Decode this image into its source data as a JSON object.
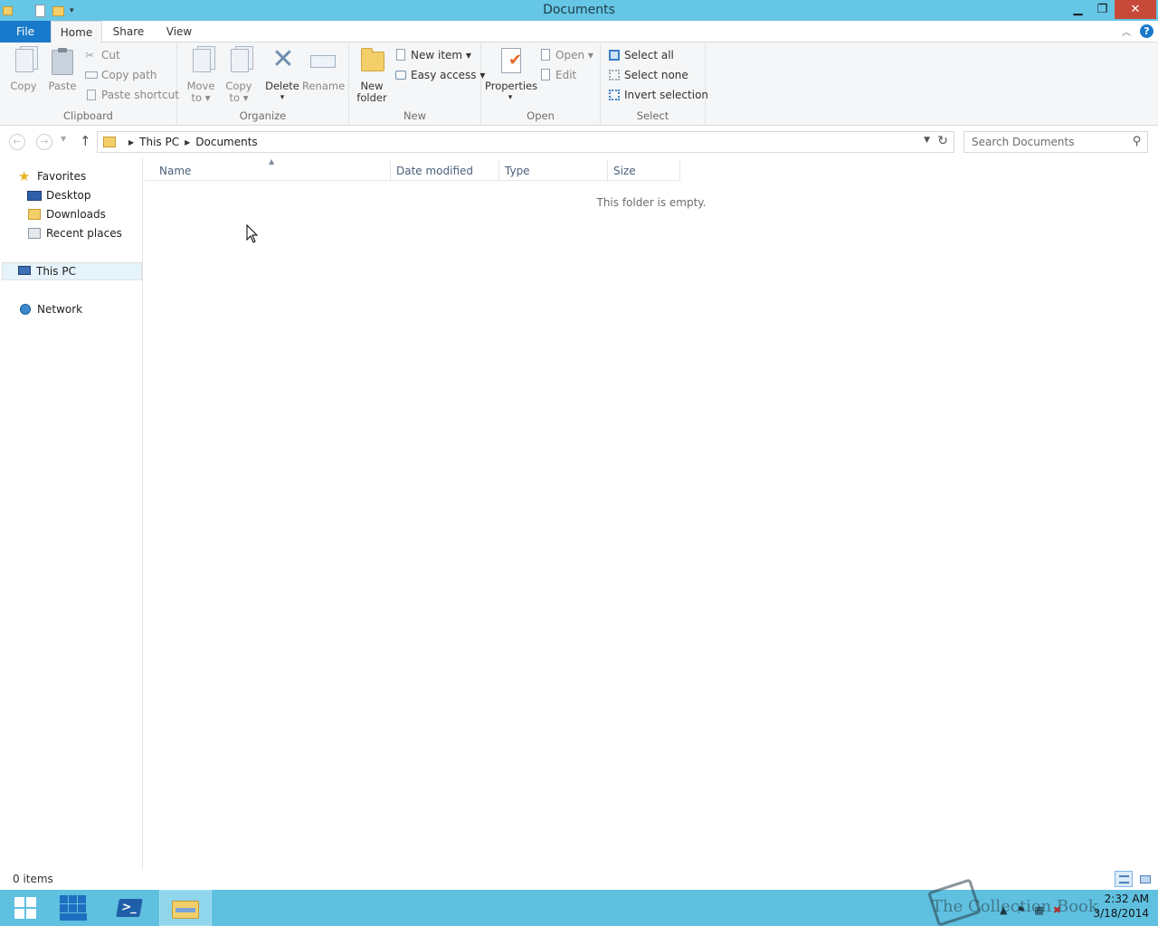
{
  "window": {
    "title": "Documents",
    "min_symbol": "▁",
    "max_symbol": "❐",
    "close_symbol": "✕"
  },
  "ribbon_tabs": {
    "file": "File",
    "home": "Home",
    "share": "Share",
    "view": "View"
  },
  "ribbon": {
    "clipboard": {
      "label": "Clipboard",
      "copy": "Copy",
      "paste": "Paste",
      "cut": "Cut",
      "copy_path": "Copy path",
      "paste_shortcut": "Paste shortcut"
    },
    "organize": {
      "label": "Organize",
      "move_to_1": "Move",
      "move_to_2": "to ▾",
      "copy_to_1": "Copy",
      "copy_to_2": "to ▾",
      "delete": "Delete",
      "delete_arrow": "▾",
      "rename": "Rename"
    },
    "new": {
      "label": "New",
      "new_folder_1": "New",
      "new_folder_2": "folder",
      "new_item": "New item ▾",
      "easy_access": "Easy access ▾"
    },
    "open": {
      "label": "Open",
      "properties": "Properties",
      "properties_arrow": "▾",
      "open": "Open ▾",
      "edit": "Edit"
    },
    "select": {
      "label": "Select",
      "select_all": "Select all",
      "select_none": "Select none",
      "invert_selection": "Invert selection"
    }
  },
  "address": {
    "crumbs": [
      "This PC",
      "Documents"
    ],
    "search_placeholder": "Search Documents"
  },
  "nav": {
    "favorites": "Favorites",
    "desktop": "Desktop",
    "downloads": "Downloads",
    "recent_places": "Recent places",
    "this_pc": "This PC",
    "network": "Network"
  },
  "columns": {
    "name": "Name",
    "date_modified": "Date modified",
    "type": "Type",
    "size": "Size"
  },
  "empty_message": "This folder is empty.",
  "status": {
    "item_count": "0 items"
  },
  "taskbar": {
    "ps_label": ">_",
    "watermark": "The Collection Book",
    "clock_time": "2:32 AM",
    "clock_date": "3/18/2014"
  },
  "colors": {
    "titlebar": "#66c6e5",
    "file_tab": "#1979ca",
    "close_button": "#c7493a",
    "taskbar": "#5fc0e0"
  }
}
